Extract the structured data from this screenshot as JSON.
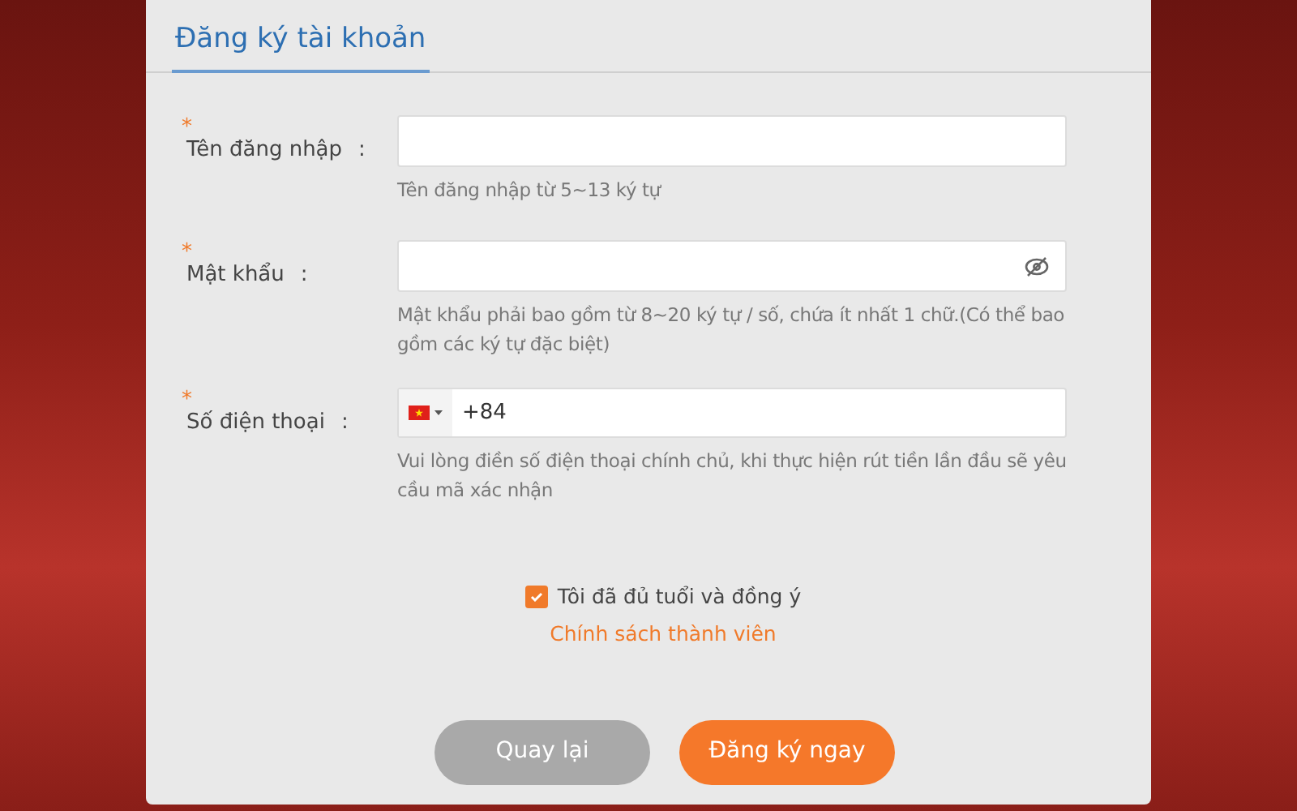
{
  "title": "Đăng ký tài khoản",
  "fields": [
    {
      "kind": "text",
      "required_mark": "*",
      "label": "Tên đăng nhập",
      "separator": ":",
      "hint": "Tên đăng nhập từ 5~13 ký tự"
    },
    {
      "kind": "password",
      "required_mark": "*",
      "label": "Mật khẩu",
      "separator": ":",
      "hint": "Mật khẩu phải bao gồm từ 8~20 ký tự / số, chứa ít nhất 1 chữ.(Có thể bao gồm các ký tự đặc biệt)"
    },
    {
      "kind": "phone",
      "required_mark": "*",
      "label": "Số điện thoại",
      "separator": ":",
      "value": "+84",
      "hint": "Vui lòng điền số điện thoại chính chủ, khi thực hiện rút tiền lần đầu sẽ yêu cầu mã xác nhận"
    }
  ],
  "agreement": {
    "checked": true,
    "label": "Tôi đã đủ tuổi và đồng ý",
    "link": "Chính sách thành viên"
  },
  "buttons": [
    {
      "kind": "secondary",
      "label": "Quay lại"
    },
    {
      "kind": "primary",
      "label": "Đăng ký ngay"
    }
  ]
}
